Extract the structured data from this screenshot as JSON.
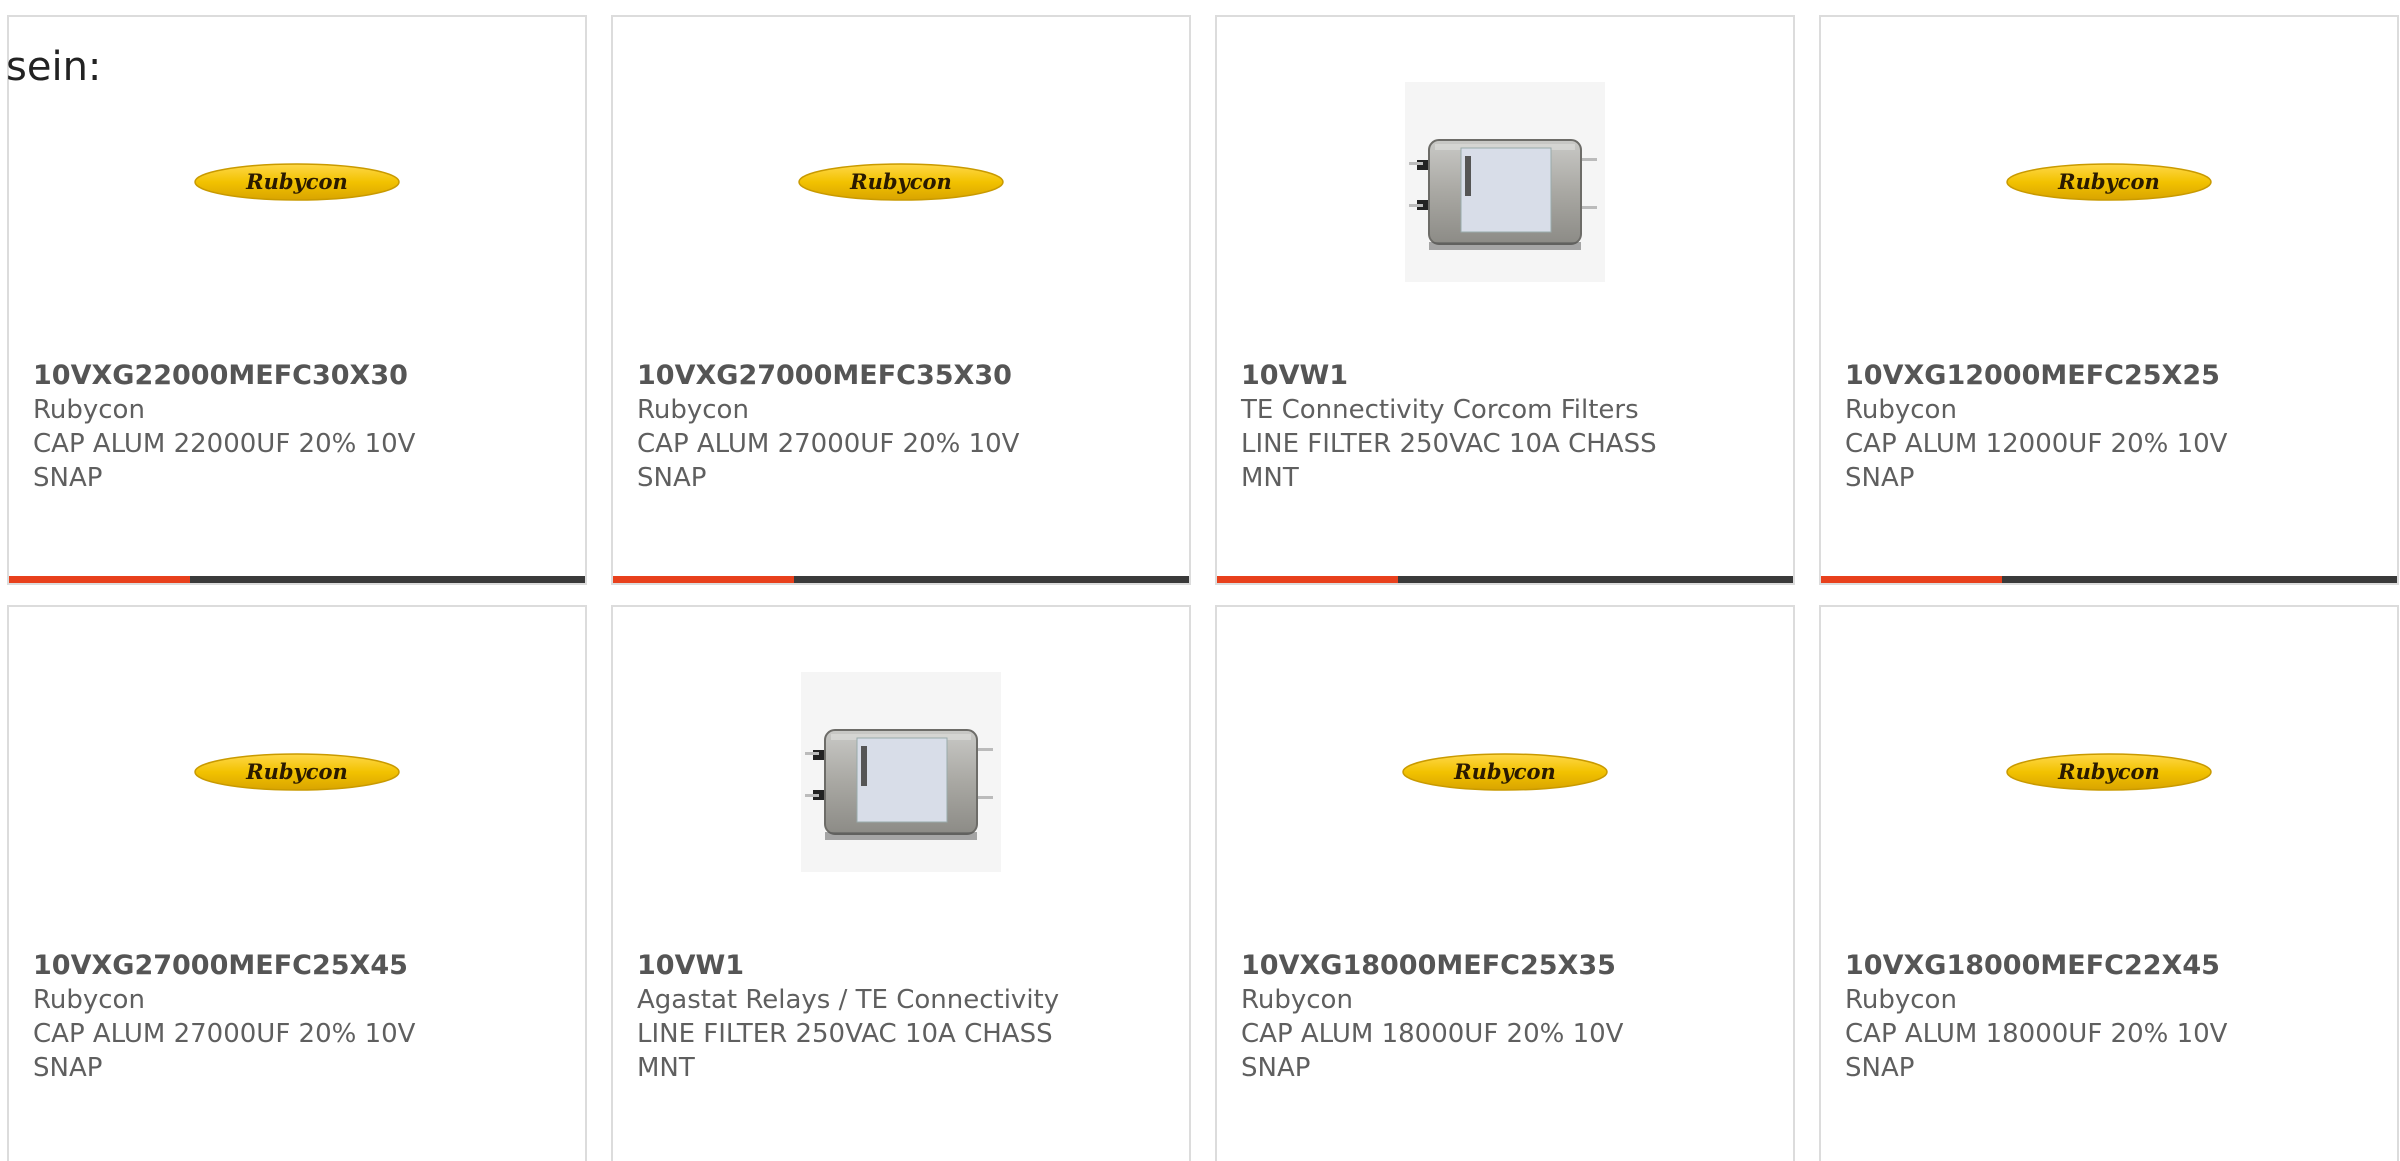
{
  "intro_text": "sein:",
  "colors": {
    "accent": "#e8401c",
    "bar_dark": "#3a3a3a",
    "card_border": "#dcdcdc",
    "rubycon_yellow": "#f2c200"
  },
  "products": [
    {
      "part_number": "10VXG22000MEFC30X30",
      "manufacturer": "Rubycon",
      "description": "CAP ALUM 22000UF 20% 10V SNAP",
      "image": "rubycon-logo",
      "logo_text": "Rubycon",
      "progress_fraction": 0.315
    },
    {
      "part_number": "10VXG27000MEFC35X30",
      "manufacturer": "Rubycon",
      "description": "CAP ALUM 27000UF 20% 10V SNAP",
      "image": "rubycon-logo",
      "logo_text": "Rubycon",
      "progress_fraction": 0.315
    },
    {
      "part_number": "10VW1",
      "manufacturer": "TE Connectivity Corcom Filters",
      "description": "LINE FILTER 250VAC 10A CHASS MNT",
      "image": "line-filter-photo",
      "logo_text": "",
      "progress_fraction": 0.315
    },
    {
      "part_number": "10VXG12000MEFC25X25",
      "manufacturer": "Rubycon",
      "description": "CAP ALUM 12000UF 20% 10V SNAP",
      "image": "rubycon-logo",
      "logo_text": "Rubycon",
      "progress_fraction": 0.315
    },
    {
      "part_number": "10VXG27000MEFC25X45",
      "manufacturer": "Rubycon",
      "description": "CAP ALUM 27000UF 20% 10V SNAP",
      "image": "rubycon-logo",
      "logo_text": "Rubycon",
      "progress_fraction": null
    },
    {
      "part_number": "10VW1",
      "manufacturer": "Agastat Relays / TE Connectivity",
      "description": "LINE FILTER 250VAC 10A CHASS MNT",
      "image": "line-filter-photo",
      "logo_text": "",
      "progress_fraction": null
    },
    {
      "part_number": "10VXG18000MEFC25X35",
      "manufacturer": "Rubycon",
      "description": "CAP ALUM 18000UF 20% 10V SNAP",
      "image": "rubycon-logo",
      "logo_text": "Rubycon",
      "progress_fraction": null
    },
    {
      "part_number": "10VXG18000MEFC22X45",
      "manufacturer": "Rubycon",
      "description": "CAP ALUM 18000UF 20% 10V SNAP",
      "image": "rubycon-logo",
      "logo_text": "Rubycon",
      "progress_fraction": null
    }
  ]
}
